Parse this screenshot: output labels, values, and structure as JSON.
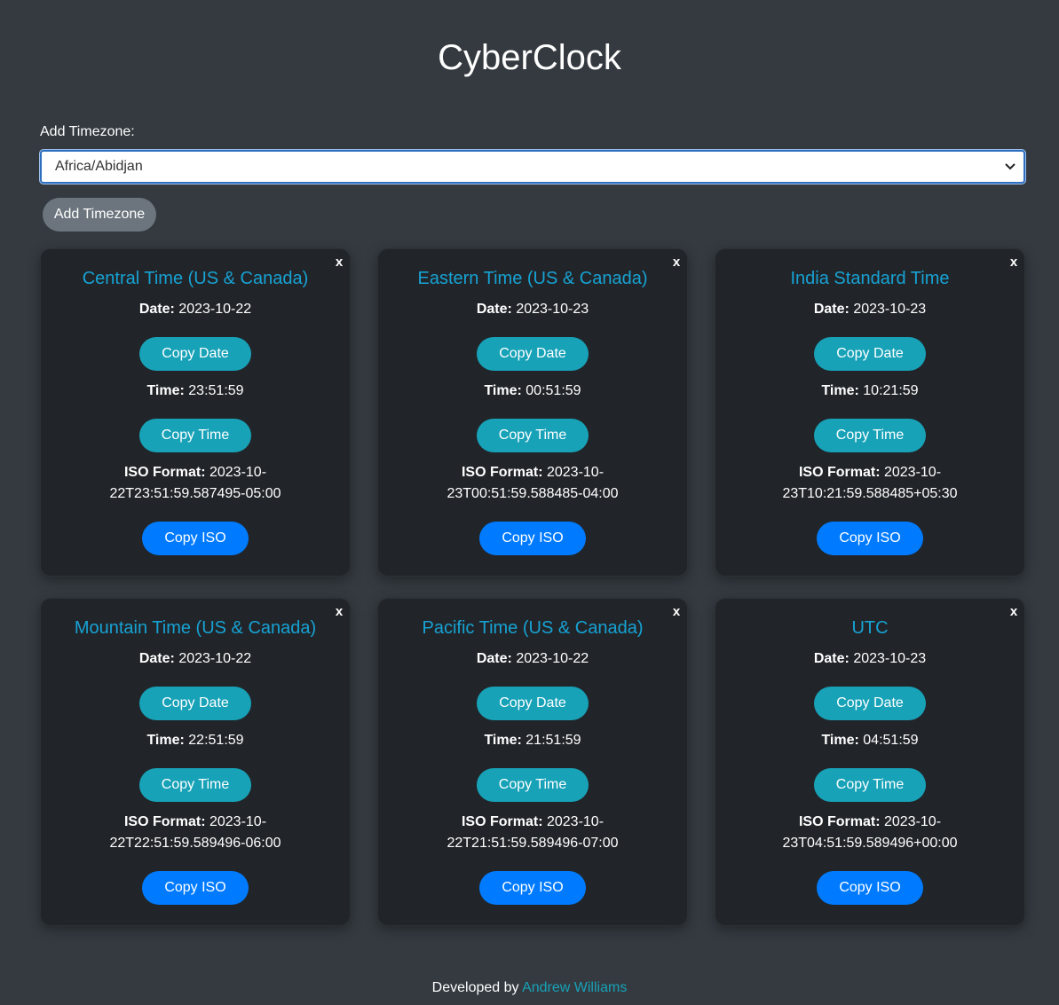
{
  "app": {
    "title": "CyberClock"
  },
  "add_timezone": {
    "label": "Add Timezone:",
    "selected": "Africa/Abidjan",
    "button": "Add Timezone"
  },
  "labels": {
    "date": "Date:",
    "time": "Time:",
    "iso": "ISO Format:",
    "copy_date": "Copy Date",
    "copy_time": "Copy Time",
    "copy_iso": "Copy ISO",
    "close": "x"
  },
  "cards": [
    {
      "name": "Central Time (US & Canada)",
      "date": "2023-10-22",
      "time": "23:51:59",
      "iso_line1": "2023-10-",
      "iso_line2": "22T23:51:59.587495-05:00"
    },
    {
      "name": "Eastern Time (US & Canada)",
      "date": "2023-10-23",
      "time": "00:51:59",
      "iso_line1": "2023-10-",
      "iso_line2": "23T00:51:59.588485-04:00"
    },
    {
      "name": "India Standard Time",
      "date": "2023-10-23",
      "time": "10:21:59",
      "iso_line1": "2023-10-",
      "iso_line2": "23T10:21:59.588485+05:30"
    },
    {
      "name": "Mountain Time (US & Canada)",
      "date": "2023-10-22",
      "time": "22:51:59",
      "iso_line1": "2023-10-",
      "iso_line2": "22T22:51:59.589496-06:00"
    },
    {
      "name": "Pacific Time (US & Canada)",
      "date": "2023-10-22",
      "time": "21:51:59",
      "iso_line1": "2023-10-",
      "iso_line2": "22T21:51:59.589496-07:00"
    },
    {
      "name": "UTC",
      "date": "2023-10-23",
      "time": "04:51:59",
      "iso_line1": "2023-10-",
      "iso_line2": "23T04:51:59.589496+00:00"
    }
  ],
  "footer": {
    "prefix": "Developed by",
    "author": "Andrew Williams"
  },
  "colors": {
    "background": "#343a40",
    "card": "#212529",
    "accent": "#17a2b8",
    "primary": "#007bff",
    "secondary": "#6c757d"
  }
}
